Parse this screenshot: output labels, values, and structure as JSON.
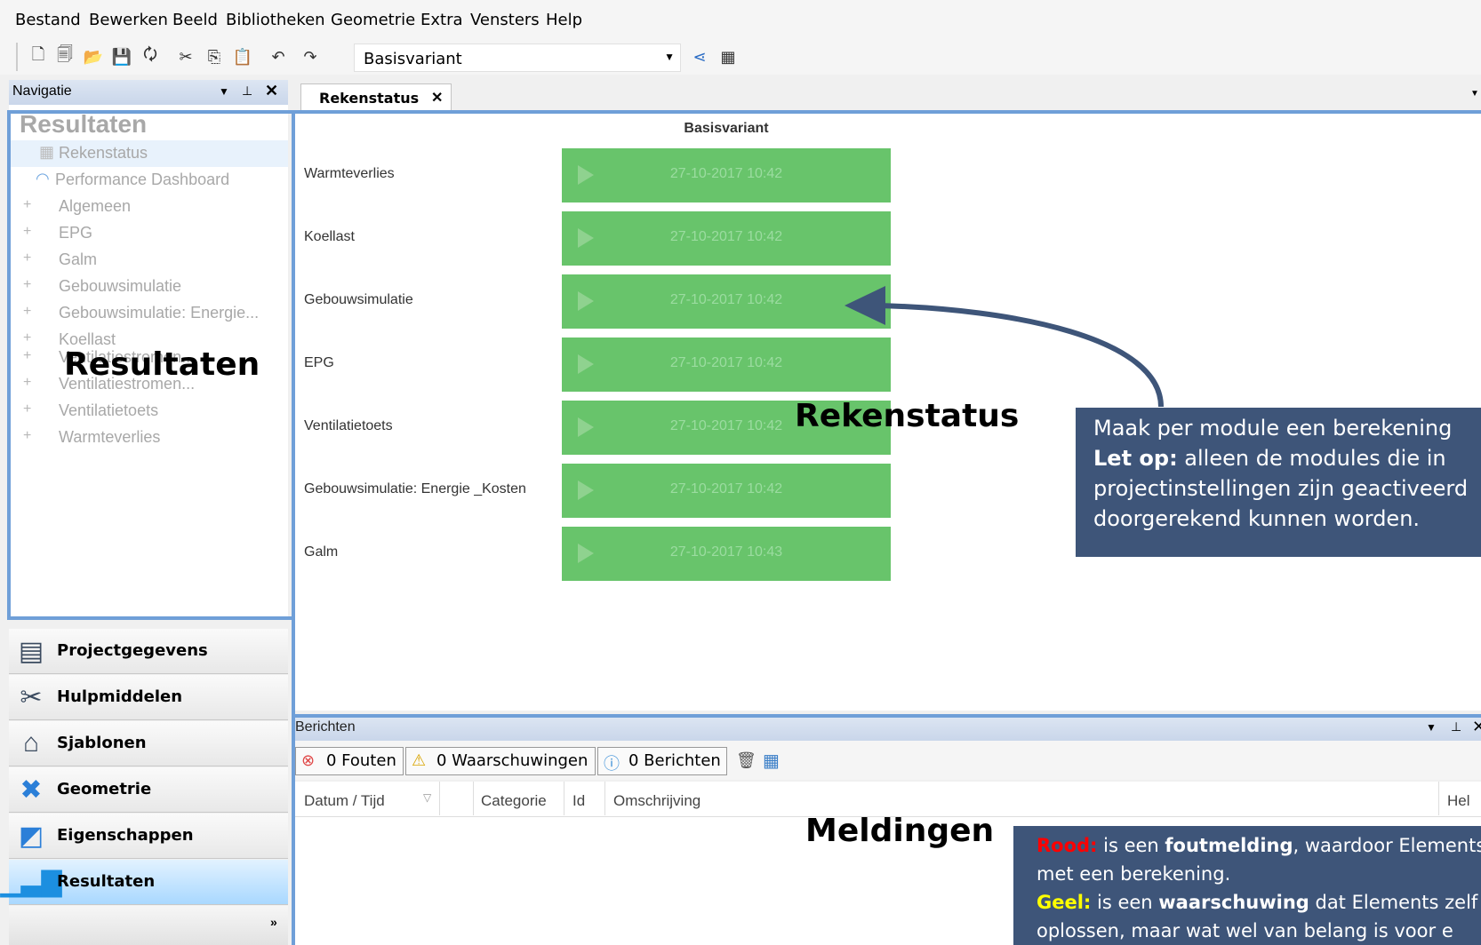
{
  "menu": [
    "Bestand",
    "Bewerken",
    "Beeld",
    "Bibliotheken",
    "Geometrie",
    "Extra",
    "Vensters",
    "Help"
  ],
  "toolbar": {
    "variant": "Basisvariant"
  },
  "nav": {
    "title": "Navigatie",
    "section_title": "Resultaten",
    "items": [
      {
        "label": "Rekenstatus",
        "icon": "calculator-icon"
      },
      {
        "label": "Performance Dashboard",
        "icon": "gauge-icon"
      },
      {
        "label": "Algemeen"
      },
      {
        "label": "EPG"
      },
      {
        "label": "Galm"
      },
      {
        "label": "Gebouwsimulatie"
      },
      {
        "label": "Gebouwsimulatie: Energie..."
      },
      {
        "label": "Koellast"
      },
      {
        "label": "Ventilatiestromen..."
      },
      {
        "label": "Ventilatiestromen..."
      },
      {
        "label": "Ventilatietoets"
      },
      {
        "label": "Warmteverlies"
      }
    ]
  },
  "left_buttons": [
    {
      "label": "Projectgegevens",
      "icon": "notebook-icon"
    },
    {
      "label": "Hulpmiddelen",
      "icon": "tools-icon"
    },
    {
      "label": "Sjablonen",
      "icon": "house-icon"
    },
    {
      "label": "Geometrie",
      "icon": "satellite-icon"
    },
    {
      "label": "Eigenschappen",
      "icon": "properties-icon"
    },
    {
      "label": "Resultaten",
      "icon": "bar-chart-icon"
    }
  ],
  "doc_tab": {
    "label": "Rekenstatus"
  },
  "rekenstatus": {
    "variant_header": "Basisvariant",
    "rows": [
      {
        "module": "Warmteverlies",
        "time": "27-10-2017 10:42"
      },
      {
        "module": "Koellast",
        "time": "27-10-2017 10:42"
      },
      {
        "module": "Gebouwsimulatie",
        "time": "27-10-2017 10:42"
      },
      {
        "module": "EPG",
        "time": "27-10-2017 10:42"
      },
      {
        "module": "Ventilatietoets",
        "time": "27-10-2017 10:42"
      },
      {
        "module": "Gebouwsimulatie: Energie _Kosten",
        "time": "27-10-2017 10:42"
      },
      {
        "module": "Galm",
        "time": "27-10-2017 10:43"
      }
    ]
  },
  "messages": {
    "title": "Berichten",
    "filters": {
      "errors": "0 Fouten",
      "warnings": "0 Waarschuwingen",
      "info": "0 Berichten"
    },
    "columns": {
      "datetime": "Datum / Tijd",
      "category": "Categorie",
      "id": "Id",
      "description": "Omschrijving",
      "help": "Hel"
    }
  },
  "annotations": {
    "resultaten": "Resultaten",
    "rekenstatus": "Rekenstatus",
    "meldingen": "Meldingen",
    "callout1": {
      "line1": "Maak per module een berekening",
      "line2_bold": "Let op:",
      "line2": " alleen de modules die in",
      "line3": "projectinstellingen zijn geactiveerd",
      "line4": "doorgerekend kunnen worden."
    },
    "callout2": {
      "rood_label": "Rood:",
      "rood_text1": " is een ",
      "rood_bold": "foutmelding",
      "rood_text2": ", waardoor Elements",
      "rood_line2": "met een berekening.",
      "geel_label": "Geel:",
      "geel_text1": " is een ",
      "geel_bold": "waarschuwing",
      "geel_text2": " dat Elements zelf",
      "geel_line2": "oplossen, maar wat wel van belang is voor e"
    }
  },
  "colors": {
    "accent_blue": "#6f9fd8",
    "status_green": "#68c46b",
    "callout_bg": "#3e5579",
    "red": "#ff0000",
    "yellow": "#ffff00"
  }
}
